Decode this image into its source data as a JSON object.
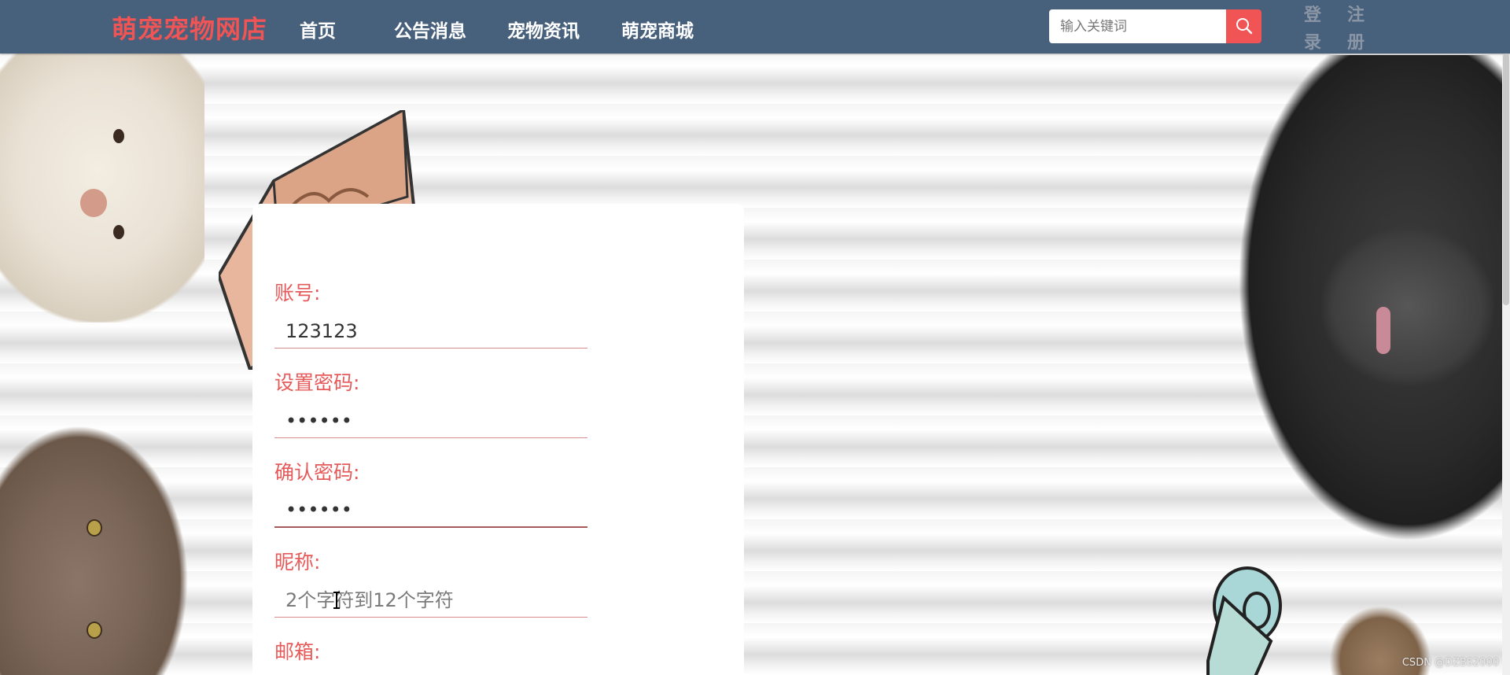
{
  "header": {
    "brand": "萌宠宠物网店",
    "nav": [
      {
        "label": "首页"
      },
      {
        "label": "公告消息"
      },
      {
        "label": "宠物资讯"
      },
      {
        "label": "萌宠商城"
      }
    ],
    "search": {
      "placeholder": "输入关键词",
      "value": ""
    },
    "auth": {
      "login": [
        "登",
        "录"
      ],
      "register": [
        "注",
        "册"
      ]
    }
  },
  "form": {
    "fields": [
      {
        "label": "账号:",
        "value": "123123",
        "placeholder": ""
      },
      {
        "label": "设置密码:",
        "value": "••••••",
        "placeholder": ""
      },
      {
        "label": "确认密码:",
        "value": "••••••",
        "placeholder": ""
      },
      {
        "label": "昵称:",
        "value": "",
        "placeholder": "2个字符到12个字符"
      },
      {
        "label": "邮箱:",
        "value": "",
        "placeholder": ""
      }
    ]
  },
  "colors": {
    "header_bg": "#47607c",
    "accent": "#f05454",
    "label": "#e65a5a",
    "auth_text": "#8a96a6"
  },
  "icons": [
    "search-icon",
    "text-cursor-icon"
  ],
  "watermark": "CSDN @DZBS2000"
}
